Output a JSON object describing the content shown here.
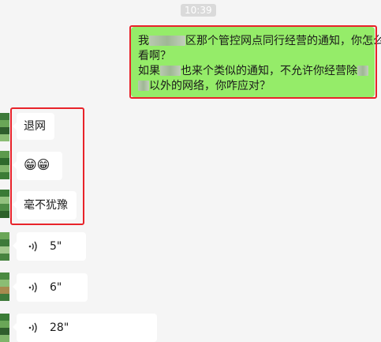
{
  "chat": {
    "timestamp": "10:39",
    "outgoing_message": {
      "line1_a": "我",
      "line1_b": "区那个管控网点同行经营的通知，你怎么",
      "line2": "看啊？",
      "line3_a": "如果",
      "line3_b": "也来个类似的通知，不允许你经营除",
      "line4_b": "以外的网络，你咋应对？"
    },
    "incoming_messages": [
      {
        "type": "text",
        "text": "退网"
      },
      {
        "type": "emoji",
        "text": "😁😁"
      },
      {
        "type": "text",
        "text": "毫不犹豫"
      }
    ],
    "voice_messages": [
      {
        "duration": "5\""
      },
      {
        "duration": "6\""
      },
      {
        "duration": "28\""
      }
    ]
  },
  "colors": {
    "outgoing_bubble": "#95ec69",
    "incoming_bubble": "#ffffff",
    "highlight_box": "#e8232a",
    "background": "#f5f5f5"
  }
}
